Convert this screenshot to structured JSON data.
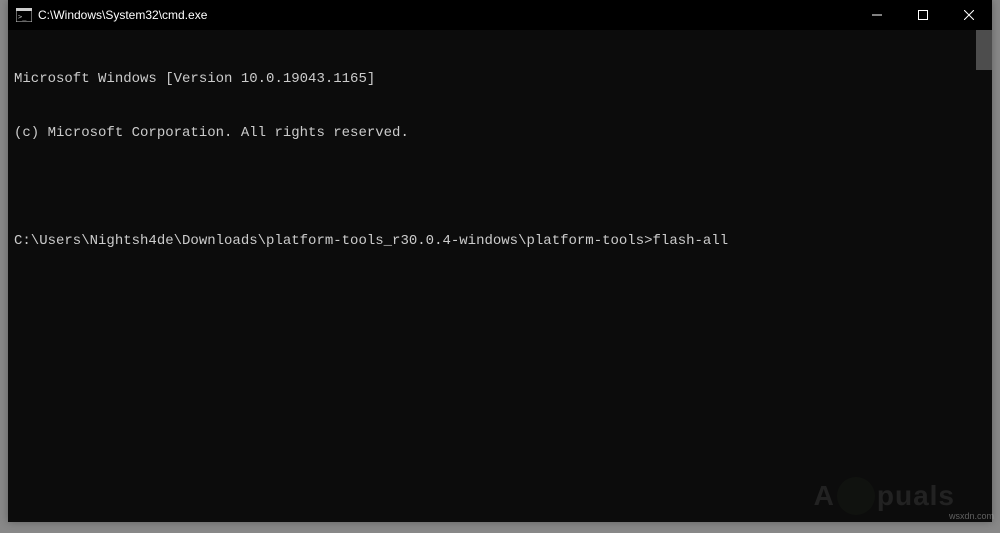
{
  "window": {
    "title": "C:\\Windows\\System32\\cmd.exe"
  },
  "terminal": {
    "line1": "Microsoft Windows [Version 10.0.19043.1165]",
    "line2": "(c) Microsoft Corporation. All rights reserved.",
    "prompt": "C:\\Users\\Nightsh4de\\Downloads\\platform-tools_r30.0.4-windows\\platform-tools>",
    "command": "flash-all"
  },
  "watermark": {
    "site": "wsxdn.com",
    "logo_text_left": "A",
    "logo_text_right": "puals"
  }
}
